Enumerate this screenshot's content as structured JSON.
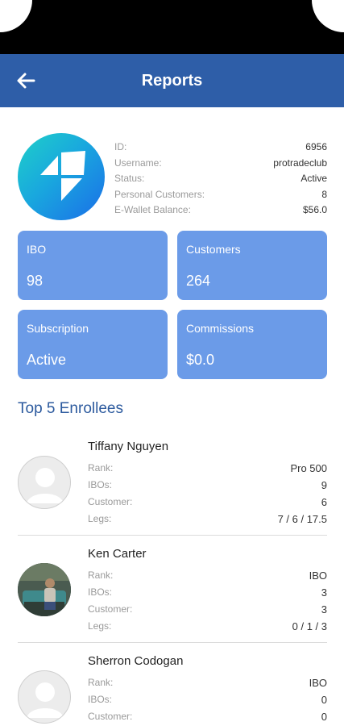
{
  "header": {
    "title": "Reports"
  },
  "profile": {
    "rows": [
      {
        "label": "ID:",
        "value": "6956"
      },
      {
        "label": "Username:",
        "value": "protradeclub"
      },
      {
        "label": "Status:",
        "value": "Active"
      },
      {
        "label": "Personal Customers:",
        "value": "8"
      },
      {
        "label": "E-Wallet Balance:",
        "value": "$56.0"
      }
    ]
  },
  "cards": {
    "ibo": {
      "label": "IBO",
      "value": "98"
    },
    "customers": {
      "label": "Customers",
      "value": "264"
    },
    "subscription": {
      "label": "Subscription",
      "value": "Active"
    },
    "commissions": {
      "label": "Commissions",
      "value": "$0.0"
    }
  },
  "enrollees_title": "Top 5 Enrollees",
  "enrollees": [
    {
      "name": "Tiffany Nguyen",
      "avatar": "person-placeholder-icon",
      "rows": [
        {
          "label": "Rank:",
          "value": "Pro 500"
        },
        {
          "label": "IBOs:",
          "value": "9"
        },
        {
          "label": "Customer:",
          "value": "6"
        },
        {
          "label": "Legs:",
          "value": "7 / 6 / 17.5"
        }
      ]
    },
    {
      "name": "Ken Carter",
      "avatar": "user-photo",
      "rows": [
        {
          "label": "Rank:",
          "value": "IBO"
        },
        {
          "label": "IBOs:",
          "value": "3"
        },
        {
          "label": "Customer:",
          "value": "3"
        },
        {
          "label": "Legs:",
          "value": "0 / 1 / 3"
        }
      ]
    },
    {
      "name": "Sherron Codogan",
      "avatar": "person-placeholder-icon",
      "rows": [
        {
          "label": "Rank:",
          "value": "IBO"
        },
        {
          "label": "IBOs:",
          "value": "0"
        },
        {
          "label": "Customer:",
          "value": "0"
        }
      ]
    }
  ],
  "colors": {
    "header_bg": "#2e5ea8",
    "card_bg": "#6b9be8",
    "section_title": "#2c5a9e"
  }
}
